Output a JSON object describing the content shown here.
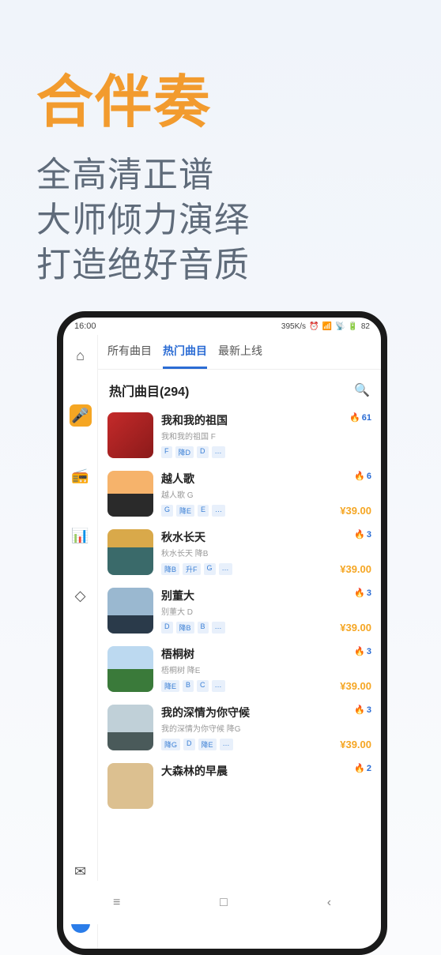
{
  "promo": {
    "title": "合伴奏",
    "line1": "全高清正谱",
    "line2": "大师倾力演绎",
    "line3": "打造绝好音质"
  },
  "statusbar": {
    "time": "16:00",
    "net": "395K/s",
    "battery": "82"
  },
  "tabs": [
    "所有曲目",
    "热门曲目",
    "最新上线"
  ],
  "section_title": "热门曲目(294)",
  "songs": [
    {
      "title": "我和我的祖国",
      "sub": "我和我的祖国 F",
      "tags": [
        "F",
        "降D",
        "D",
        "…"
      ],
      "hot": "61",
      "price": ""
    },
    {
      "title": "越人歌",
      "sub": "越人歌 G",
      "tags": [
        "G",
        "降E",
        "E",
        "…"
      ],
      "hot": "6",
      "price": "¥39.00"
    },
    {
      "title": "秋水长天",
      "sub": "秋水长天 降B",
      "tags": [
        "降B",
        "升F",
        "G",
        "…"
      ],
      "hot": "3",
      "price": "¥39.00"
    },
    {
      "title": "别董大",
      "sub": "别董大 D",
      "tags": [
        "D",
        "降B",
        "B",
        "…"
      ],
      "hot": "3",
      "price": "¥39.00"
    },
    {
      "title": "梧桐树",
      "sub": "梧桐树 降E",
      "tags": [
        "降E",
        "B",
        "C",
        "…"
      ],
      "hot": "3",
      "price": "¥39.00"
    },
    {
      "title": "我的深情为你守候",
      "sub": "我的深情为你守候 降G",
      "tags": [
        "降G",
        "D",
        "降E",
        "…"
      ],
      "hot": "3",
      "price": "¥39.00"
    },
    {
      "title": "大森林的早晨",
      "sub": "",
      "tags": [],
      "hot": "2",
      "price": ""
    }
  ],
  "navkeys": {
    "menu": "≡",
    "home": "□",
    "back": "‹"
  }
}
